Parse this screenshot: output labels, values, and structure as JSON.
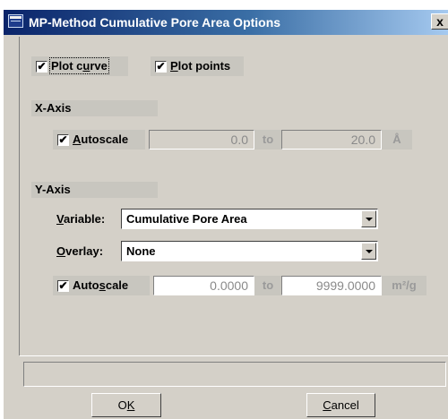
{
  "window": {
    "title": "MP-Method Cumulative Pore Area Options",
    "close_glyph": "x"
  },
  "options": {
    "plot_curve": {
      "checked": true,
      "mark": "✔",
      "label": "Plot curve"
    },
    "plot_points": {
      "checked": true,
      "mark": "✔",
      "label": "Plot points"
    }
  },
  "x_axis": {
    "heading": "X-Axis",
    "autoscale": {
      "checked": true,
      "mark": "✔",
      "label": "Autoscale"
    },
    "min": "0.0",
    "to": "to",
    "max": "20.0",
    "unit": "Å"
  },
  "y_axis": {
    "heading": "Y-Axis",
    "variable_label": "Variable:",
    "variable_value": "Cumulative Pore Area",
    "overlay_label": "Overlay:",
    "overlay_value": "None",
    "autoscale": {
      "checked": true,
      "mark": "✔",
      "label": "Autoscale"
    },
    "min": "0.0000",
    "to": "to",
    "max": "9999.0000",
    "unit": "m²/g"
  },
  "status": {
    "text": ""
  },
  "buttons": {
    "ok": "OK",
    "cancel": "Cancel"
  },
  "colors": {
    "dialog_face": "#d4d0c8",
    "title_start": "#0a246a",
    "title_end": "#a6caf0"
  }
}
